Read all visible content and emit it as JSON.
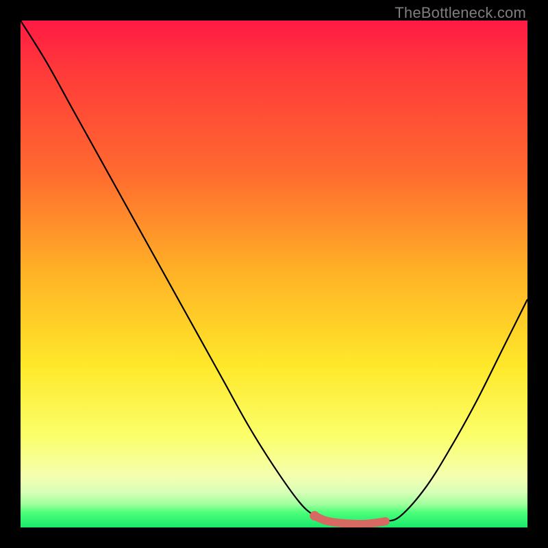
{
  "attribution": "TheBottleneck.com",
  "colors": {
    "curve_stroke": "#000000",
    "marker_stroke": "#d66a63",
    "marker_fill": "#d66a63"
  },
  "chart_data": {
    "type": "line",
    "title": "",
    "xlabel": "",
    "ylabel": "",
    "xlim": [
      0,
      100
    ],
    "ylim": [
      0,
      100
    ],
    "series": [
      {
        "name": "bottleneck-curve",
        "x": [
          0,
          5,
          10,
          15,
          20,
          25,
          30,
          35,
          40,
          45,
          50,
          55,
          58,
          60,
          62,
          65,
          68,
          70,
          72,
          75,
          80,
          85,
          90,
          95,
          100
        ],
        "values": [
          100,
          92,
          83,
          74,
          65,
          56,
          47,
          38,
          29,
          20,
          12,
          5,
          2.3,
          1.4,
          1.0,
          0.7,
          0.7,
          0.9,
          1.2,
          2.3,
          8,
          16,
          25,
          35,
          45
        ]
      }
    ],
    "markers": {
      "name": "optimal-range",
      "x": [
        58,
        60,
        62,
        64,
        66,
        68,
        70,
        72
      ],
      "values": [
        2.3,
        1.4,
        1.0,
        0.8,
        0.7,
        0.7,
        0.9,
        1.2
      ]
    }
  }
}
